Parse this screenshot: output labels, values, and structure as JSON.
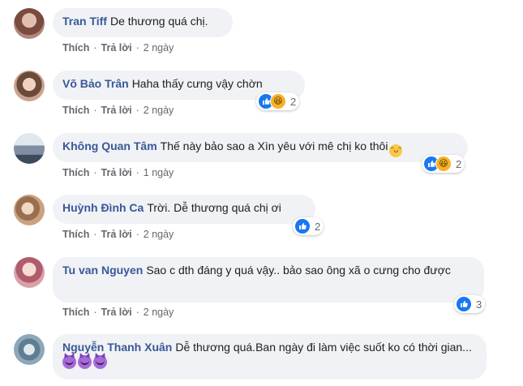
{
  "comments": [
    {
      "name": "Tran Tiff",
      "text": "De thương quá chị.",
      "actions": {
        "like": "Thích",
        "reply": "Trả lời",
        "time": "2 ngày"
      },
      "avatar_color": "#b2857a"
    },
    {
      "name": "Võ Bảo Trân",
      "text": "Haha thấy cưng vậy chờn",
      "actions": {
        "like": "Thích",
        "reply": "Trả lời",
        "time": "2 ngày"
      },
      "reactions": {
        "icons": [
          "like-icon",
          "haha-icon"
        ],
        "count": "2"
      },
      "avatar_color": "#caa48e"
    },
    {
      "name": "Không Quan Tâm",
      "text": "Thế này bảo sao a Xìn yêu với mê chị ko thôi",
      "actions": {
        "like": "Thích",
        "reply": "Trả lời",
        "time": "1 ngày"
      },
      "reactions": {
        "icons": [
          "like-icon",
          "haha-icon"
        ],
        "count": "2"
      },
      "avatar_color": "#7f8ea3"
    },
    {
      "name": "Huỳnh Đình Ca",
      "text": "Trời. Dễ thương quá chị ơi",
      "actions": {
        "like": "Thích",
        "reply": "Trả lời",
        "time": "2 ngày"
      },
      "reactions": {
        "icons": [
          "like-icon"
        ],
        "count": "2"
      },
      "avatar_color": "#c9a27f"
    },
    {
      "name": "Tu van Nguyen",
      "text": "Sao c dth đáng y quá vậy.. bảo sao ông xã o cưng cho được",
      "actions": {
        "like": "Thích",
        "reply": "Trả lời",
        "time": "2 ngày"
      },
      "reactions": {
        "icons": [
          "like-icon"
        ],
        "count": "3"
      },
      "avatar_color": "#d9a0a8"
    },
    {
      "name": "Nguyễn Thanh Xuân",
      "text": "Dễ thương quá.Ban ngày đi làm việc suốt ko có thời gian...",
      "avatar_color": "#8fa7b8"
    }
  ],
  "separator": "·",
  "colors": {
    "name": "#385898",
    "bubble": "#f0f2f5",
    "meta": "#65676b",
    "like": "#1877f2",
    "haha": "#f7b125"
  }
}
